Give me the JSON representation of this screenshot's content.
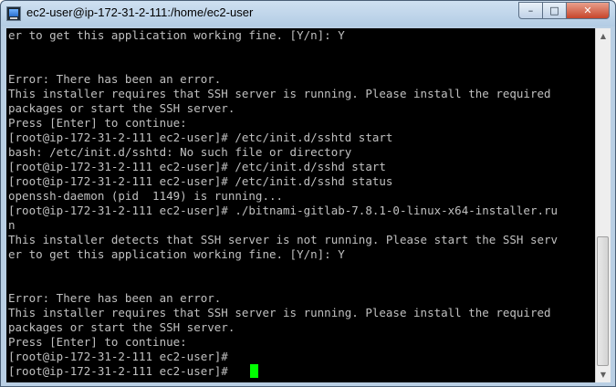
{
  "window": {
    "title": "ec2-user@ip-172-31-2-111:/home/ec2-user",
    "icon": "putty-terminal-icon",
    "controls": {
      "minimize": "–",
      "maximize": "□",
      "close": "✕"
    }
  },
  "terminal": {
    "lines": [
      "er to get this application working fine. [Y/n]: Y",
      "",
      "",
      "Error: There has been an error.",
      "This installer requires that SSH server is running. Please install the required",
      "packages or start the SSH server.",
      "Press [Enter] to continue:",
      "[root@ip-172-31-2-111 ec2-user]# /etc/init.d/sshtd start",
      "bash: /etc/init.d/sshtd: No such file or directory",
      "[root@ip-172-31-2-111 ec2-user]# /etc/init.d/sshd start",
      "[root@ip-172-31-2-111 ec2-user]# /etc/init.d/sshd status",
      "openssh-daemon (pid  1149) is running...",
      "[root@ip-172-31-2-111 ec2-user]# ./bitnami-gitlab-7.8.1-0-linux-x64-installer.ru",
      "n",
      "This installer detects that SSH server is not running. Please start the SSH serv",
      "er to get this application working fine. [Y/n]: Y",
      "",
      "",
      "Error: There has been an error.",
      "This installer requires that SSH server is running. Please install the required",
      "packages or start the SSH server.",
      "Press [Enter] to continue:",
      "[root@ip-172-31-2-111 ec2-user]#",
      "[root@ip-172-31-2-111 ec2-user]# "
    ],
    "colors": {
      "background": "#000000",
      "foreground": "#c0c0c0",
      "cursor": "#00ff00"
    }
  }
}
